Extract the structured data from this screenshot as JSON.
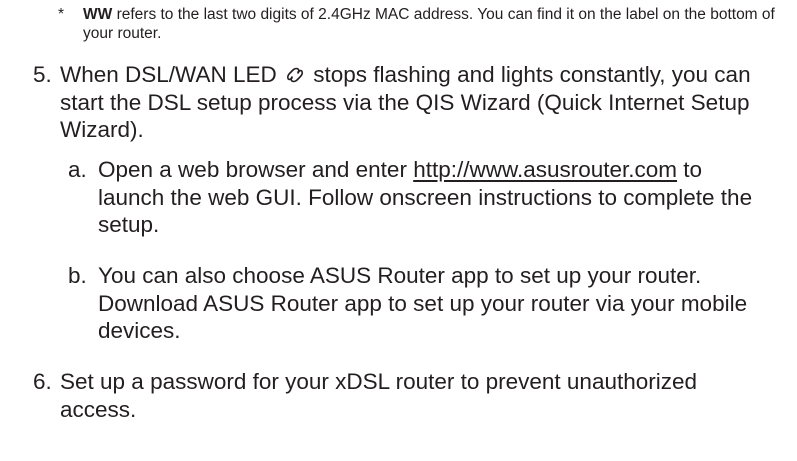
{
  "footnote": {
    "marker": "*",
    "bold": "WW",
    "text": " refers to the last two digits of 2.4GHz MAC address. You can find it on the label on the bottom of your router."
  },
  "step5": {
    "number": "5.",
    "text_before_icon": "When DSL/WAN LED ",
    "icon": "globe-link-icon",
    "text_after_icon": " stops flashing and lights constantly, you can start the DSL setup process via the QIS Wizard (Quick Internet Setup Wizard)."
  },
  "step5a": {
    "letter": "a.",
    "text_before_link": "Open a web browser and enter ",
    "link": "http://www.asusrouter.com",
    "text_after_link": " to launch the web GUI. Follow onscreen instructions to complete the setup."
  },
  "step5b": {
    "letter": "b.",
    "text": "You can also choose ASUS Router app to set up your router. Download ASUS Router app to set up your router via your mobile devices."
  },
  "step6": {
    "number": "6.",
    "text": "Set up a password for your xDSL router to prevent unauthorized access."
  }
}
